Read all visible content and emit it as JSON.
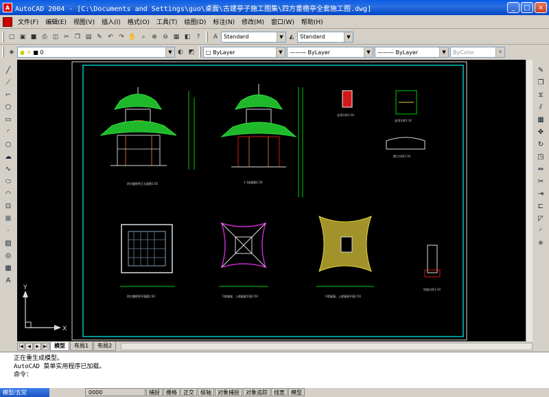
{
  "window": {
    "title": "AutoCAD 2004 - [C:\\Documents and Settings\\guo\\桌面\\古建亭子施工图集\\四方重檐亭全套施工图.dwg]",
    "app_icon": "autocad-logo-icon",
    "min": "_",
    "max": "□",
    "close": "×"
  },
  "menubar": {
    "items": [
      "文件(F)",
      "编辑(E)",
      "视图(V)",
      "插入(I)",
      "格式(O)",
      "工具(T)",
      "绘图(D)",
      "标注(N)",
      "修改(M)",
      "窗口(W)",
      "帮助(H)"
    ],
    "text_style": "Standard",
    "dim_style": "Standard"
  },
  "layer_toolbar": {
    "layer_name": "0",
    "color": "ByLayer",
    "linetype": "ByLayer",
    "lineweight": "ByLayer",
    "plotstyle": "ByColor"
  },
  "drawing": {
    "labels": [
      "四方重檐亭正立面图1:50",
      "1-1剖面图1:50",
      "宝顶大样1:10",
      "宝顶大样1:10",
      "檐口大样1:10",
      "四方重檐亭平面图1:50",
      "下檐屋架、上檐屋架平面1:50",
      "下檐屋面、上檐屋面平面1:50",
      "柱础大样1:10"
    ],
    "ucs_x": "X",
    "ucs_y": "Y"
  },
  "tabs": {
    "items": [
      "模型",
      "布局1",
      "布局2"
    ],
    "active": "模型",
    "nav": [
      "|◀",
      "◀",
      "▶",
      "▶|"
    ]
  },
  "command": {
    "lines": [
      "正在重生成模型。",
      "AutoCAD 菜单实用程序已加载。",
      "命令："
    ]
  },
  "status": {
    "taskbar": "模型/五觉",
    "coords": "0000",
    "toggles": [
      "捕捉",
      "栅格",
      "正交",
      "极轴",
      "对象捕捉",
      "对象追踪",
      "线宽",
      "模型"
    ]
  },
  "colors": {
    "canvas": "#000000",
    "border_cyan": "#00c8c8",
    "roof_green": "#22c832",
    "accent_red": "#d01818",
    "magenta": "#c828c8",
    "yellow": "#e6d23c"
  }
}
